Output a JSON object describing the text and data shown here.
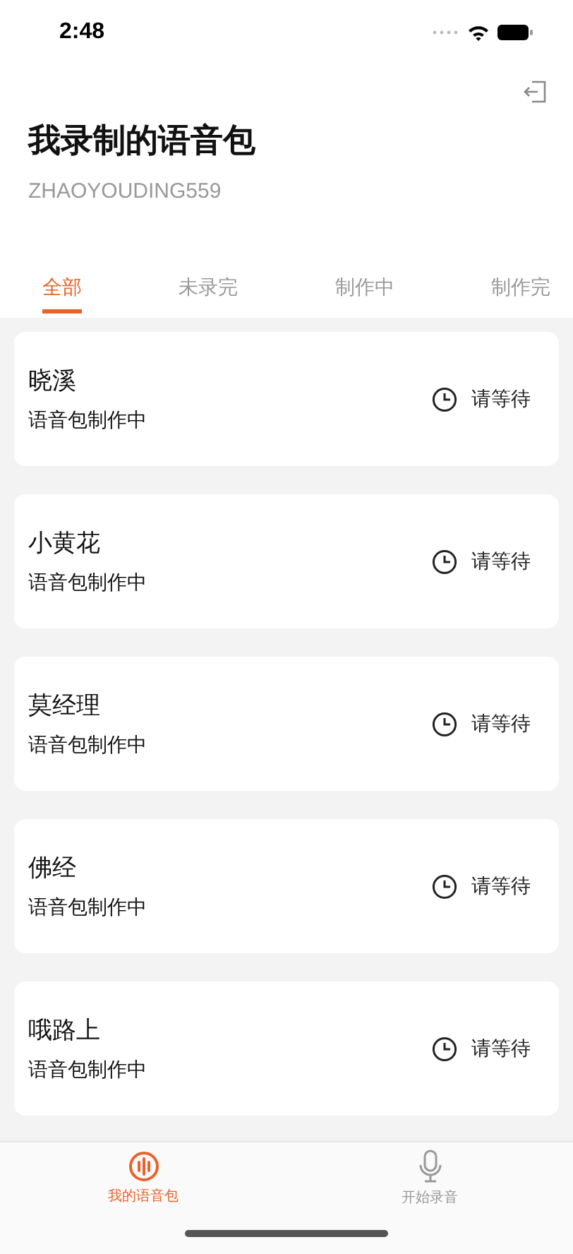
{
  "status_bar": {
    "time": "2:48"
  },
  "header": {
    "title": "我录制的语音包",
    "username": "ZHAOYOUDING559"
  },
  "tabs": [
    {
      "label": "全部",
      "selected": true
    },
    {
      "label": "未录完",
      "selected": false
    },
    {
      "label": "制作中",
      "selected": false
    },
    {
      "label": "制作完",
      "selected": false
    }
  ],
  "packs": [
    {
      "name": "晓溪",
      "status": "语音包制作中",
      "action": "请等待"
    },
    {
      "name": "小黄花",
      "status": "语音包制作中",
      "action": "请等待"
    },
    {
      "name": "莫经理",
      "status": "语音包制作中",
      "action": "请等待"
    },
    {
      "name": "佛经",
      "status": "语音包制作中",
      "action": "请等待"
    },
    {
      "name": "哦路上",
      "status": "语音包制作中",
      "action": "请等待"
    }
  ],
  "bottom_nav": [
    {
      "label": "我的语音包",
      "kind": "packs",
      "selected": true
    },
    {
      "label": "开始录音",
      "kind": "record",
      "selected": false
    }
  ]
}
